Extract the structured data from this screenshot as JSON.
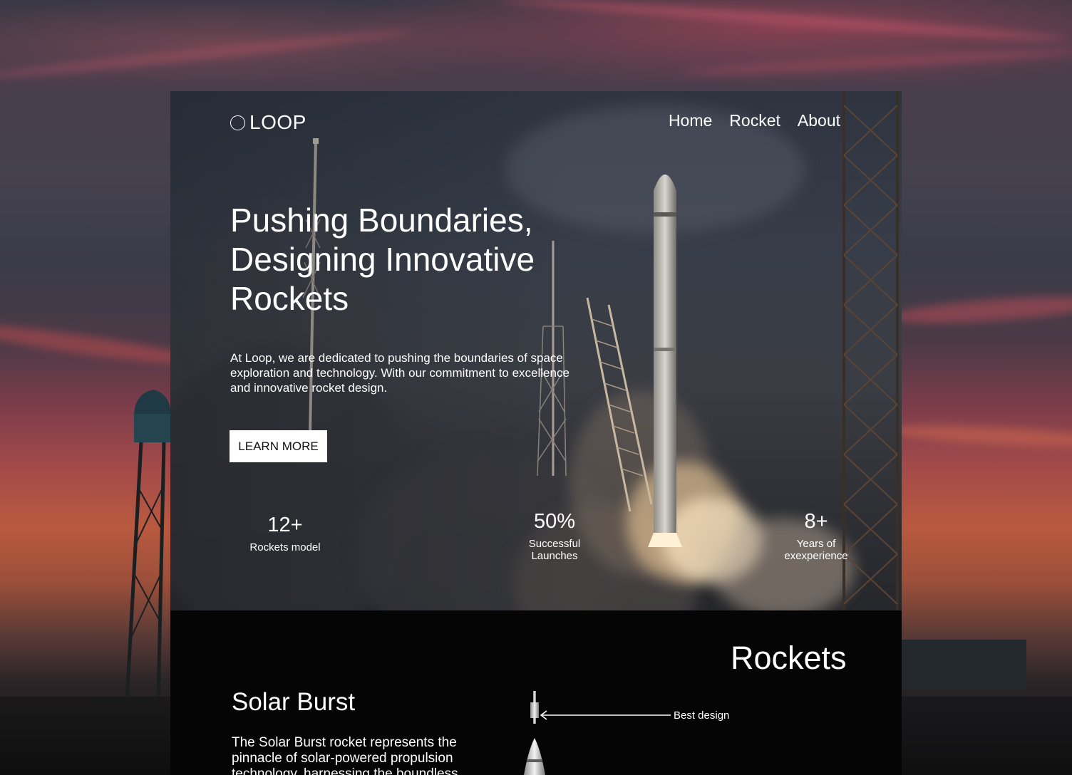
{
  "brand": {
    "name": "LOOP"
  },
  "nav": {
    "items": [
      "Home",
      "Rocket",
      "About"
    ]
  },
  "hero": {
    "headline": "Pushing Boundaries, Designing Innovative Rockets",
    "description": "At Loop, we are dedicated to pushing the boundaries of space exploration and technology. With our commitment to excellence and innovative rocket design.",
    "cta_label": "LEARN MORE"
  },
  "stats": [
    {
      "value": "12+",
      "label": "Rockets model"
    },
    {
      "value": "50%",
      "label": "Successful Launches"
    },
    {
      "value": "8+",
      "label": "Years of exexperience"
    }
  ],
  "rockets": {
    "title": "Rockets",
    "featured": {
      "name": "Solar Burst",
      "description": "The Solar Burst rocket represents the pinnacle of solar-powered propulsion technology, harnessing the boundless",
      "annotation": "Best design"
    }
  },
  "colors": {
    "cta_bg": "#ffffff",
    "section_bg": "#050505",
    "text": "#ffffff"
  }
}
